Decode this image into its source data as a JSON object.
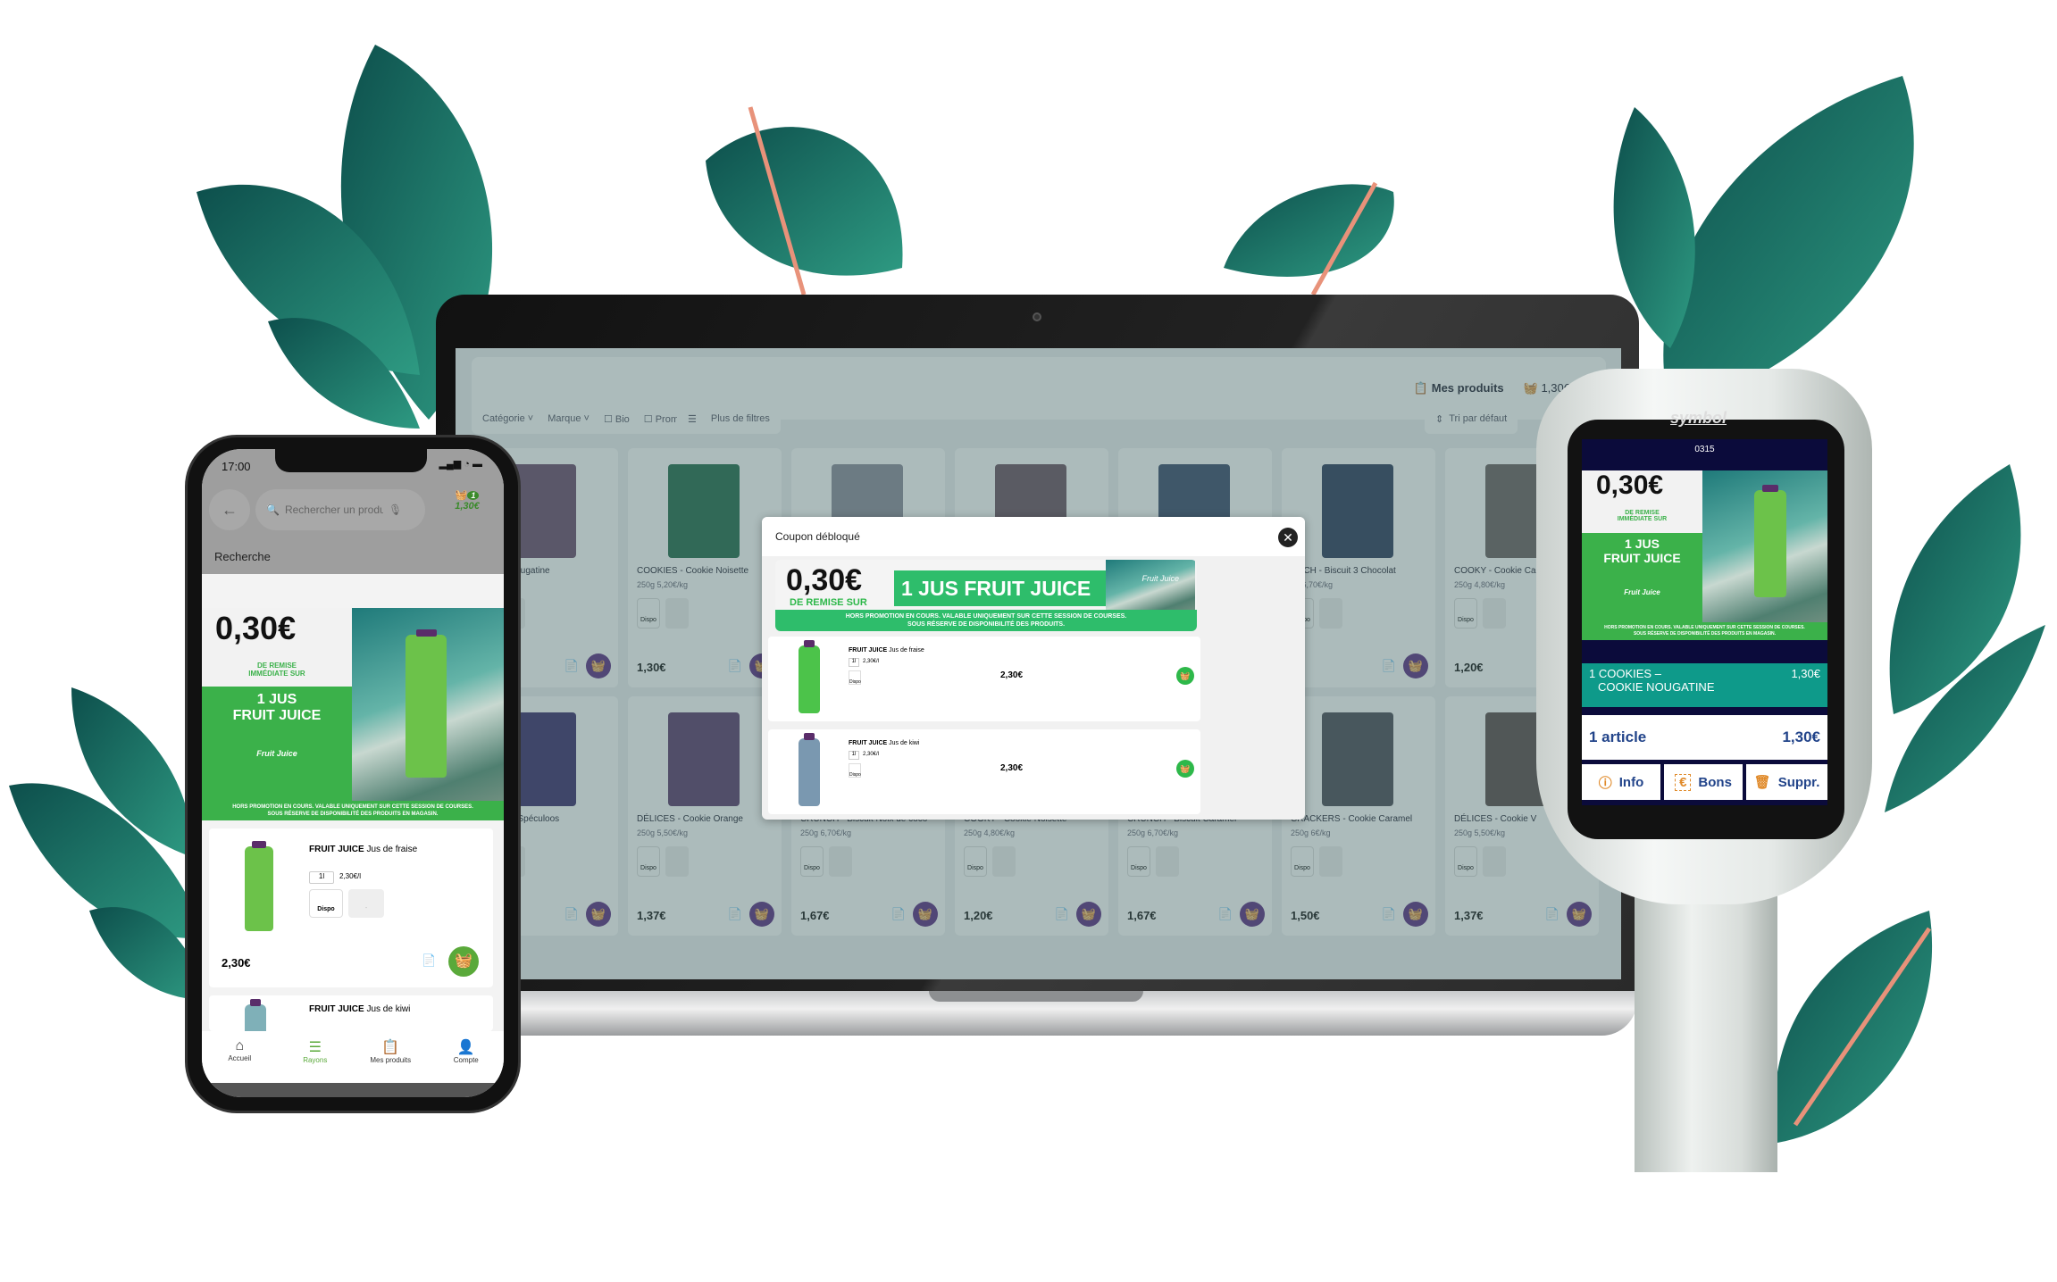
{
  "colors": {
    "accent_green": "#3bb14a",
    "teal": "#0e9a8a",
    "purple": "#5a2d82",
    "scanner_navy": "#0b0b3b",
    "leaf": "#0e5a55"
  },
  "coupon": {
    "amount": "0,30€",
    "sub_short": "DE REMISE SUR",
    "sub_long_1": "DE REMISE",
    "sub_long_2": "IMMÉDIATE SUR",
    "product_line1": "1 JUS",
    "product_line2": "FRUIT JUICE",
    "product_full": "1 JUS FRUIT JUICE",
    "brand_logo": "Fruit Juice",
    "disclaimer_1": "HORS PROMOTION EN COURS. VALABLE UNIQUEMENT SUR CETTE SESSION DE COURSES.",
    "disclaimer_2": "SOUS RÉSERVE DE DISPONIBILITÉ DES PRODUITS.",
    "disclaimer_2_store": "SOUS RÉSERVE DE DISPONIBILITÉ DES PRODUITS EN MAGASIN."
  },
  "laptop": {
    "topbar": {
      "my_products": "Mes produits",
      "cart_total": "1,30€"
    },
    "filters": {
      "category": "Catégorie",
      "brand": "Marque",
      "bio": "Bio",
      "promo": "Promo",
      "more": "Plus de filtres",
      "sort": "Tri par défaut"
    },
    "row1": [
      {
        "name": "- Cookie Nougatine",
        "weight": "€/kg",
        "price": "",
        "qty": "1",
        "color": "#6b4a6a"
      },
      {
        "name": "COOKIES - Cookie Noisette",
        "weight": "250g  5,20€/kg",
        "price": "1,30€",
        "color": "#1f6a4a"
      },
      {
        "name": "",
        "weight": "",
        "price": "",
        "color": "#8a8a9a"
      },
      {
        "name": "",
        "weight": "",
        "price": "",
        "color": "#6a5060"
      },
      {
        "name": "",
        "weight": "",
        "price": "",
        "color": "#3a4a6a"
      },
      {
        "name": "UNCH - Biscuit 3 Chocolat",
        "weight": "0g  6,70€/kg",
        "price": "7€",
        "color": "#2a3a5a"
      },
      {
        "name": "COOKY - Cookie Car",
        "weight": "250g  4,80€/kg",
        "price": "1,20€",
        "color": "#6a6060"
      }
    ],
    "row2": [
      {
        "name": "S - Cookie Spéculoos",
        "weight": "g",
        "price": "",
        "color": "#3a2a6a"
      },
      {
        "name": "DÉLICES - Cookie Orange",
        "weight": "250g  5,50€/kg",
        "price": "1,37€",
        "color": "#5a3a6a"
      },
      {
        "name": "CRUNCH - Biscuit Noix de coco",
        "weight": "250g  6,70€/kg",
        "price": "1,67€",
        "color": "#6a6a7a"
      },
      {
        "name": "COOKY - Cookie Noisette",
        "weight": "250g  4,80€/kg",
        "price": "1,20€",
        "color": "#5a4a5a"
      },
      {
        "name": "CRUNCH - Biscuit Caramel",
        "weight": "250g  6,70€/kg",
        "price": "1,67€",
        "color": "#4a4a5a"
      },
      {
        "name": "CRACKERS - Cookie Caramel",
        "weight": "250g  6€/kg",
        "price": "1,50€",
        "color": "#4a4a55"
      },
      {
        "name": "DÉLICES - Cookie V",
        "weight": "250g  5,50€/kg",
        "price": "1,37€",
        "color": "#5a4a4a"
      }
    ],
    "modal": {
      "title": "Coupon débloqué",
      "items": [
        {
          "brand": "FRUIT JUICE",
          "name": "Jus de fraise",
          "size": "1l",
          "unit_price": "2,30€/l",
          "stock": "Dispo",
          "price": "2,30€",
          "bottle": "#4cc34a"
        },
        {
          "brand": "FRUIT JUICE",
          "name": "Jus de kiwi",
          "size": "1l",
          "unit_price": "2,30€/l",
          "stock": "Dispo",
          "price": "2,30€",
          "bottle": "#7a98b0"
        }
      ]
    }
  },
  "phone": {
    "time": "17:00",
    "search_placeholder": "Rechercher un produit",
    "cart_count": "1",
    "cart_total": "1,30€",
    "section": "Recherche",
    "items": [
      {
        "brand": "FRUIT JUICE",
        "name": "Jus de fraise",
        "size": "1l",
        "unit_price": "2,30€/l",
        "stock": "Dispo",
        "stock_unavailable": "-",
        "price": "2,30€"
      },
      {
        "brand": "FRUIT JUICE",
        "name": "Jus de kiwi"
      }
    ],
    "nav": [
      {
        "label": "Accueil",
        "icon": "home-icon"
      },
      {
        "label": "Rayons",
        "icon": "aisles-icon",
        "active": true
      },
      {
        "label": "Mes produits",
        "icon": "my-products-icon"
      },
      {
        "label": "Compte",
        "icon": "account-icon"
      }
    ]
  },
  "scanner": {
    "brand": "symbol",
    "code": "0315",
    "line_item": {
      "label_1": "1 COOKIES –",
      "label_2": "COOKIE NOUGATINE",
      "price": "1,30€"
    },
    "total": {
      "label": "1 article",
      "price": "1,30€"
    },
    "buttons": {
      "info": "Info",
      "vouchers": "Bons",
      "voucher_icon": "€",
      "delete": "Suppr."
    }
  }
}
